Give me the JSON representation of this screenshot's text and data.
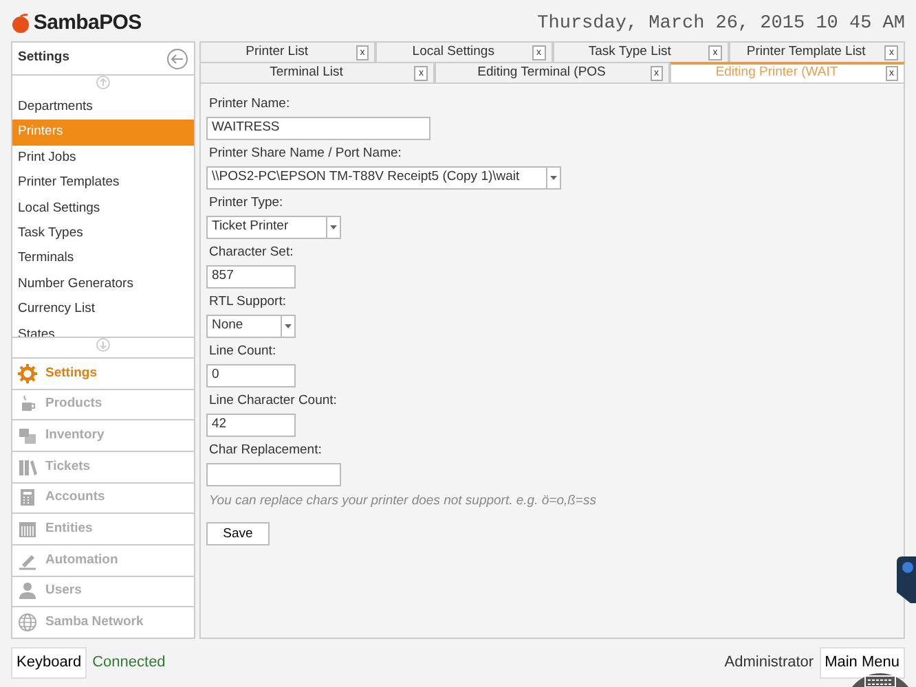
{
  "header": {
    "logo": "SambaPOS",
    "datetime": "Thursday, March 26, 2015 10 45 AM"
  },
  "sidebar": {
    "title": "Settings",
    "items": [
      {
        "label": "Departments",
        "selected": false
      },
      {
        "label": "Printers",
        "selected": true
      },
      {
        "label": "Print Jobs",
        "selected": false
      },
      {
        "label": "Printer Templates",
        "selected": false
      },
      {
        "label": "Local Settings",
        "selected": false
      },
      {
        "label": "Task Types",
        "selected": false
      },
      {
        "label": "Terminals",
        "selected": false
      },
      {
        "label": "Number Generators",
        "selected": false
      },
      {
        "label": "Currency List",
        "selected": false
      },
      {
        "label": "States",
        "selected": false
      }
    ]
  },
  "navigation": [
    {
      "label": "Settings",
      "selected": true
    },
    {
      "label": "Products",
      "selected": false
    },
    {
      "label": "Inventory",
      "selected": false
    },
    {
      "label": "Tickets",
      "selected": false
    },
    {
      "label": "Accounts",
      "selected": false
    },
    {
      "label": "Entities",
      "selected": false
    },
    {
      "label": "Automation",
      "selected": false
    },
    {
      "label": "Users",
      "selected": false
    },
    {
      "label": "Samba Network",
      "selected": false
    }
  ],
  "tab_rows": [
    [
      {
        "label": "Printer List",
        "close": "x",
        "selected": false
      },
      {
        "label": "Local Settings",
        "close": "x",
        "selected": false
      },
      {
        "label": "Task Type List",
        "close": "x",
        "selected": false
      },
      {
        "label": "Printer Template List",
        "close": "x",
        "selected": false
      }
    ],
    [
      {
        "label": "Terminal List",
        "close": "x",
        "selected": false
      },
      {
        "label": "Editing Terminal (POS",
        "close": "x",
        "selected": false
      },
      {
        "label": "Editing Printer (WAIT",
        "close": "x",
        "selected": true
      }
    ]
  ],
  "form": {
    "fields": [
      {
        "label": "Printer Name:",
        "kind": "text",
        "value": "WAITRESS"
      },
      {
        "label": "Printer Share Name / Port Name:",
        "kind": "select",
        "value": "\\\\POS2-PC\\EPSON TM-T88V Receipt5 (Copy 1)\\wait"
      },
      {
        "label": "Printer Type:",
        "kind": "select",
        "value": "Ticket Printer"
      },
      {
        "label": "Character Set:",
        "kind": "text",
        "value": "857"
      },
      {
        "label": "RTL Support:",
        "kind": "select",
        "value": "None"
      },
      {
        "label": "Line Count:",
        "kind": "text",
        "value": "0"
      },
      {
        "label": "Line Character Count:",
        "kind": "text",
        "value": "42"
      },
      {
        "label": "Char Replacement:",
        "kind": "text"
      }
    ],
    "hint": "You can replace chars your printer does not support. e.g. ö=o,ß=ss",
    "save_button": "Save"
  },
  "status_bar": {
    "keyboard_button": "Keyboard",
    "connection": "Connected",
    "user": "Administrator",
    "main_menu_button": "Main Menu"
  }
}
